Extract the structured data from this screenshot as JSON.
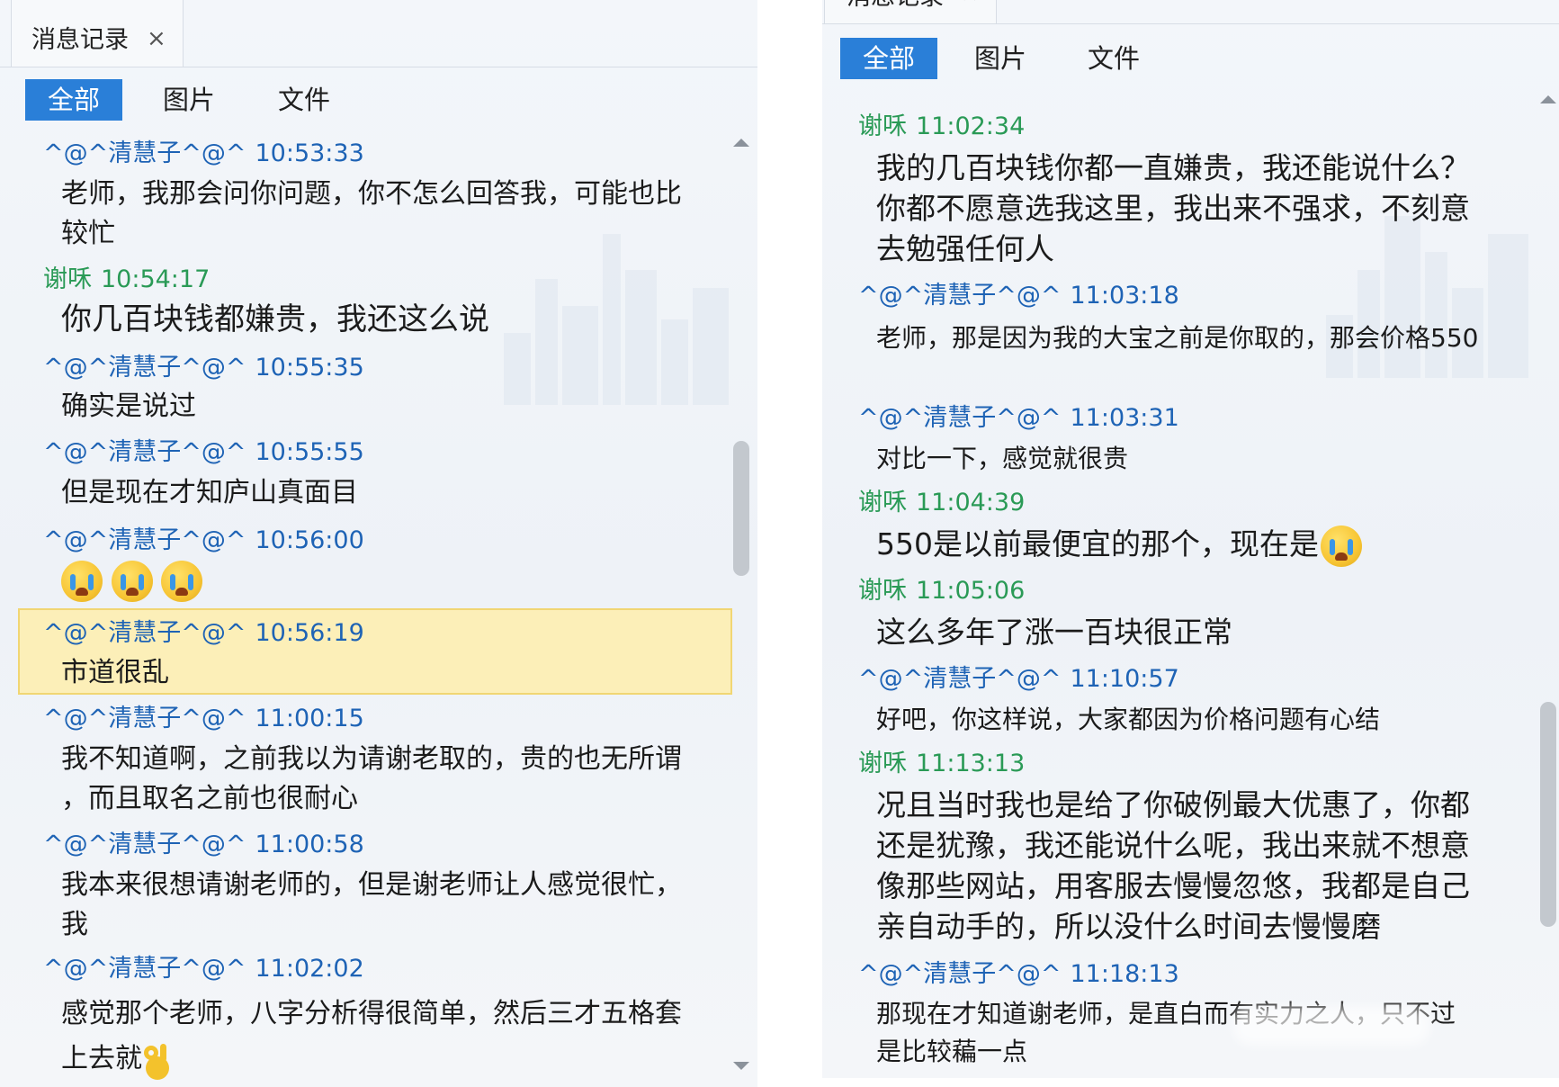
{
  "left": {
    "title_tab": {
      "label": "消息记录",
      "close_symbol": "×"
    },
    "filter_tabs": [
      {
        "label": "全部",
        "active": true
      },
      {
        "label": "图片",
        "active": false
      },
      {
        "label": "文件",
        "active": false
      }
    ],
    "messages": [
      {
        "sender": "^@^清慧子^@^",
        "time": "10:53:33",
        "from": "them",
        "lines": [
          "老师，我那会问你问题，你不怎么回答我，可能也比",
          "较忙"
        ]
      },
      {
        "sender": "谢咊",
        "time": "10:54:17",
        "from": "me",
        "lines": [
          "你几百块钱都嫌贵，我还这么说"
        ]
      },
      {
        "sender": "^@^清慧子^@^",
        "time": "10:55:35",
        "from": "them",
        "lines": [
          "确实是说过"
        ]
      },
      {
        "sender": "^@^清慧子^@^",
        "time": "10:55:55",
        "from": "them",
        "lines": [
          "但是现在才知庐山真面目"
        ]
      },
      {
        "sender": "^@^清慧子^@^",
        "time": "10:56:00",
        "from": "them",
        "lines": [],
        "emoji": [
          "loudly-crying-emoji",
          "loudly-crying-emoji",
          "loudly-crying-emoji"
        ]
      },
      {
        "sender": "^@^清慧子^@^",
        "time": "10:56:19",
        "from": "them",
        "lines": [
          "市道很乱"
        ],
        "highlighted": true
      },
      {
        "sender": "^@^清慧子^@^",
        "time": "11:00:15",
        "from": "them",
        "lines": [
          "我不知道啊，之前我以为请谢老取的，贵的也无所谓",
          "，而且取名之前也很耐心"
        ]
      },
      {
        "sender": "^@^清慧子^@^",
        "time": "11:00:58",
        "from": "them",
        "lines": [
          "我本来很想请谢老师的，但是谢老师让人感觉很忙，",
          "我"
        ]
      },
      {
        "sender": "^@^清慧子^@^",
        "time": "11:02:02",
        "from": "them",
        "lines": [
          "感觉那个老师，八字分析得很简单，然后三才五格套",
          "上去就"
        ],
        "trailing_emoji": "ok-hand-emoji"
      }
    ]
  },
  "right": {
    "title_tab": {
      "label": "消息记录",
      "close_symbol": "×"
    },
    "filter_tabs": [
      {
        "label": "全部",
        "active": true
      },
      {
        "label": "图片",
        "active": false
      },
      {
        "label": "文件",
        "active": false
      }
    ],
    "messages": [
      {
        "sender": "谢咊",
        "time": "11:02:34",
        "from": "me",
        "lines": [
          "我的几百块钱你都一直嫌贵，我还能说什么？",
          "你都不愿意选我这里，我出来不强求，不刻意",
          "去勉强任何人"
        ]
      },
      {
        "sender": "^@^清慧子^@^",
        "time": "11:03:18",
        "from": "them",
        "lines": [
          "老师，那是因为我的大宝之前是你取的，那会价格550"
        ]
      },
      {
        "sender": "^@^清慧子^@^",
        "time": "11:03:31",
        "from": "them",
        "lines": [
          "对比一下，感觉就很贵"
        ]
      },
      {
        "sender": "谢咊",
        "time": "11:04:39",
        "from": "me",
        "lines": [
          "550是以前最便宜的那个，现在是"
        ],
        "trailing_emoji": "loudly-crying-emoji"
      },
      {
        "sender": "谢咊",
        "time": "11:05:06",
        "from": "me",
        "lines": [
          "这么多年了涨一百块很正常"
        ]
      },
      {
        "sender": "^@^清慧子^@^",
        "time": "11:10:57",
        "from": "them",
        "lines": [
          "好吧，你这样说，大家都因为价格问题有心结"
        ]
      },
      {
        "sender": "谢咊",
        "time": "11:13:13",
        "from": "me",
        "lines": [
          "况且当时我也是给了你破例最大优惠了，你都",
          "还是犹豫，我还能说什么呢，我出来就不想意",
          "像那些网站，用客服去慢慢忽悠，我都是自己",
          "亲自动手的，所以没什么时间去慢慢磨"
        ]
      },
      {
        "sender": "^@^清慧子^@^",
        "time": "11:18:13",
        "from": "them",
        "lines": [
          "那现在才知道谢老师，是直白而有实力之人，只不过",
          "是比较藊一点"
        ]
      }
    ]
  },
  "colors": {
    "them_sender": "#1e63b5",
    "me_sender": "#2a9a56",
    "active_tab": "#2a7fd8",
    "highlight": "#fcefb8"
  }
}
